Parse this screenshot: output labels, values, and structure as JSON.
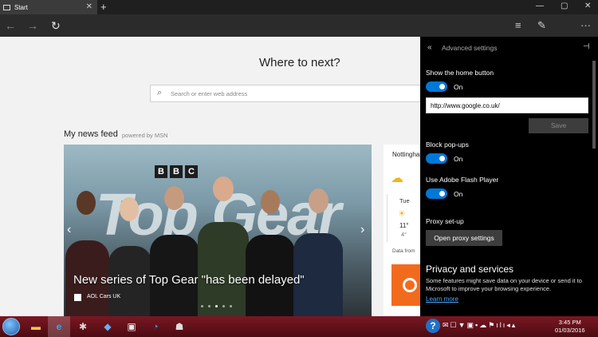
{
  "titlebar": {
    "tab_title": "Start",
    "tab_close": "✕",
    "new_tab": "+",
    "minimize": "—",
    "maximize": "▢",
    "close": "✕"
  },
  "navbar": {
    "back": "←",
    "forward": "→",
    "refresh": "↻",
    "hub": "≡",
    "note": "✎",
    "more": "···"
  },
  "start_page": {
    "heading": "Where to next?",
    "search_placeholder": "Search or enter web address",
    "feed_title": "My news feed",
    "feed_powered": "powered by MSN",
    "hero": {
      "logo_letters": [
        "B",
        "B",
        "C"
      ],
      "logo_wordmark": "Top Gear",
      "headline": "New series of Top Gear \"has been delayed\"",
      "source": "AOL Cars UK",
      "prev": "‹",
      "next": "›",
      "active_slide": 3,
      "slide_count": 5
    },
    "weather": {
      "city": "Nottingham",
      "day": "Tue",
      "high": "11°",
      "low": "4°",
      "data_from": "Data from"
    }
  },
  "settings": {
    "title": "Advanced settings",
    "back_icon": "«",
    "pin_icon": "⊣",
    "home_button_label": "Show the home button",
    "home_button_state": "On",
    "home_url": "http://www.google.co.uk/",
    "save_label": "Save",
    "popups_label": "Block pop-ups",
    "popups_state": "On",
    "flash_label": "Use Adobe Flash Player",
    "flash_state": "On",
    "proxy_label": "Proxy set-up",
    "proxy_button": "Open proxy settings",
    "privacy_title": "Privacy and services",
    "privacy_desc": "Some features might save data on your device or send it to Microsoft to improve your browsing experience.",
    "learn_more": "Learn more",
    "accent_color": "#0078d7"
  },
  "taskbar": {
    "help_icon": "?",
    "time": "3:45 PM",
    "date": "01/03/2016"
  }
}
